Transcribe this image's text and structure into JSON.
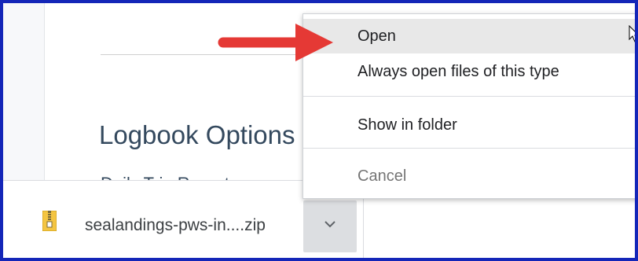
{
  "page": {
    "heading": "Logbook Options",
    "partial_text": "Daily Trip Reports"
  },
  "download": {
    "file_name": "sealandings-pws-in....zip",
    "icon": "zip-file-icon",
    "menu_button_icon": "chevron-down-icon"
  },
  "context_menu": {
    "items": [
      {
        "label": "Open",
        "highlighted": true,
        "enabled": true
      },
      {
        "label": "Always open files of this type",
        "highlighted": false,
        "enabled": true
      },
      {
        "label": "Show in folder",
        "highlighted": false,
        "enabled": true
      },
      {
        "label": "Cancel",
        "highlighted": false,
        "enabled": false
      }
    ]
  },
  "annotation": {
    "arrow_color": "#e53935",
    "frame_color": "#1426b8"
  }
}
